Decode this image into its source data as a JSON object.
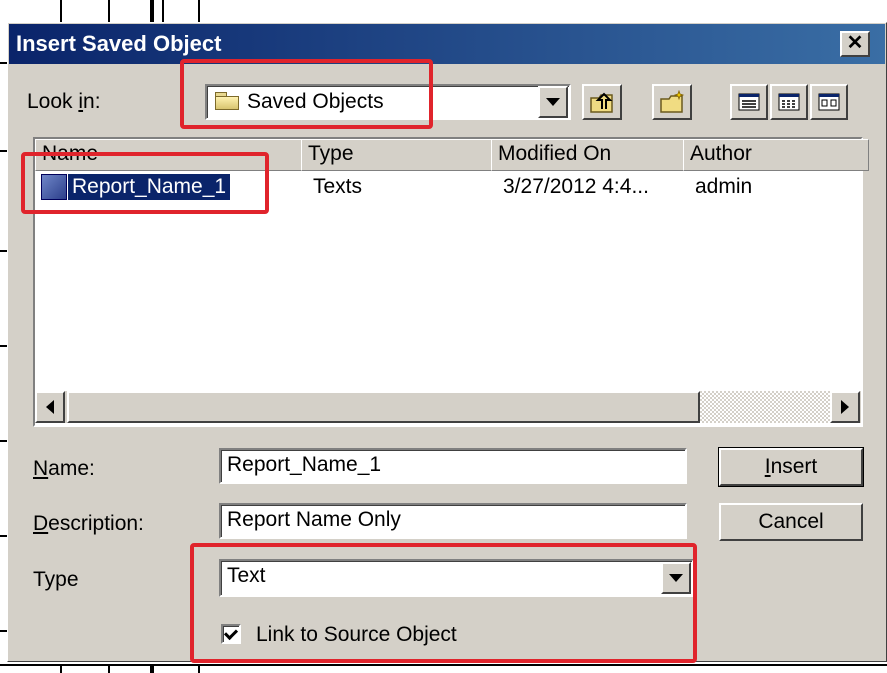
{
  "dialog": {
    "title": "Insert Saved Object",
    "close_glyph": "✕"
  },
  "look_in": {
    "label_prefix": "Look ",
    "label_accel": "i",
    "label_suffix": "n:",
    "value": "Saved Objects",
    "icon": "folder-icon"
  },
  "toolbar": {
    "buttons": [
      "up-folder-icon",
      "new-folder-icon",
      "list-view-icon",
      "details-view-icon",
      "thumbnail-view-icon"
    ]
  },
  "list": {
    "columns": [
      "Name",
      "Type",
      "Modified On",
      "Author"
    ],
    "rows": [
      {
        "name": "Report_Name_1",
        "type": "Texts",
        "modified": "3/27/2012 4:4...",
        "author": "admin"
      }
    ]
  },
  "form": {
    "name_label_accel": "N",
    "name_label_rest": "ame:",
    "name_value": "Report_Name_1",
    "description_label_accel": "D",
    "description_label_rest": "escription:",
    "description_value": "Report Name Only",
    "type_label": "Type",
    "type_value": "Text",
    "link_checkbox_label": "Link to Source Object",
    "link_checked": true
  },
  "buttons": {
    "insert_accel": "I",
    "insert_rest": "nsert",
    "cancel": "Cancel"
  },
  "colors": {
    "titlebar_start": "#0a246a",
    "titlebar_end": "#3a6ea5",
    "dialog_face": "#d4d0c8",
    "selection": "#0a246a",
    "annotation": "#e0242c"
  }
}
